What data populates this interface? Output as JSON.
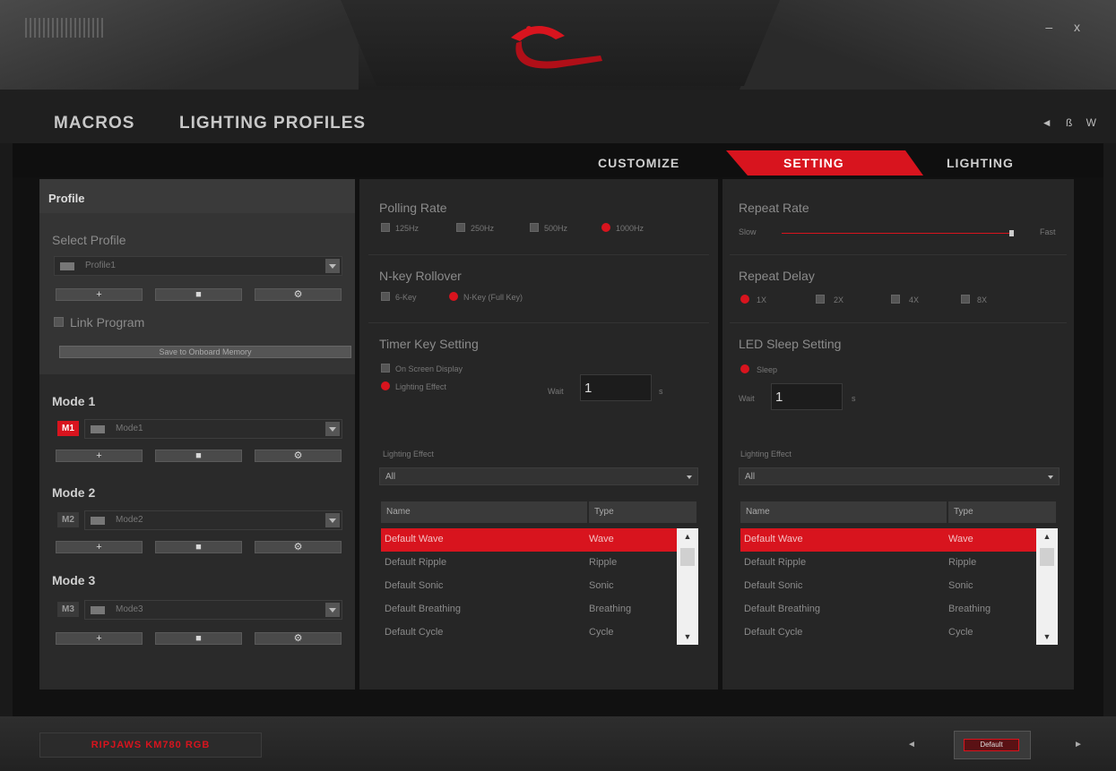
{
  "window": {
    "controls": "– x"
  },
  "nav": {
    "macros": "MACROS",
    "lighting_profiles": "LIGHTING PROFILES",
    "lang": "◄ ß W"
  },
  "tabs": {
    "customize": "CUSTOMIZE",
    "setting": "SETTING",
    "lighting": "LIGHTING"
  },
  "profile": {
    "header": "Profile",
    "select_label": "Select Profile",
    "selected": "Profile1",
    "add": "+",
    "remove": "■",
    "settings": "⚙",
    "link_program": "Link Program",
    "save_label": "Save to Onboard Memory"
  },
  "modes": [
    {
      "title": "Mode 1",
      "tag": "M1",
      "name": "Mode1",
      "active": true
    },
    {
      "title": "Mode 2",
      "tag": "M2",
      "name": "Mode2",
      "active": false
    },
    {
      "title": "Mode 3",
      "tag": "M3",
      "name": "Mode3",
      "active": false
    }
  ],
  "polling": {
    "title": "Polling Rate",
    "options": [
      "125Hz",
      "250Hz",
      "500Hz",
      "1000Hz"
    ],
    "selected": "1000Hz"
  },
  "rollover": {
    "title": "N-key Rollover",
    "options": [
      "6-Key",
      "N-Key (Full Key)"
    ],
    "selected": "N-Key (Full Key)"
  },
  "timer": {
    "title": "Timer Key Setting",
    "options": [
      "On Screen Display",
      "Lighting Effect"
    ],
    "selected": "Lighting Effect",
    "wait_label": "Wait",
    "wait_value": "1",
    "unit": "s"
  },
  "repeat_rate": {
    "title": "Repeat Rate",
    "slow": "Slow",
    "fast": "Fast",
    "level": 1.0
  },
  "repeat_delay": {
    "title": "Repeat Delay",
    "options": [
      "1X",
      "2X",
      "4X",
      "8X"
    ],
    "selected": "1X"
  },
  "led_sleep": {
    "title": "LED Sleep Setting",
    "option": "Sleep",
    "wait_label": "Wait",
    "wait_value": "1",
    "unit": "s"
  },
  "lighting_effect": {
    "label": "Lighting Effect",
    "filter": "All",
    "columns": [
      "Name",
      "Type"
    ],
    "rows": [
      [
        "Default Wave",
        "Wave"
      ],
      [
        "Default Ripple",
        "Ripple"
      ],
      [
        "Default Sonic",
        "Sonic"
      ],
      [
        "Default Breathing",
        "Breathing"
      ],
      [
        "Default Cycle",
        "Cycle"
      ]
    ]
  },
  "device": {
    "name": "RIPJAWS KM780 RGB"
  },
  "pager": {
    "label": "Default"
  },
  "colors": {
    "accent": "#d8141e",
    "panel": "#262626",
    "background": "#111111"
  }
}
